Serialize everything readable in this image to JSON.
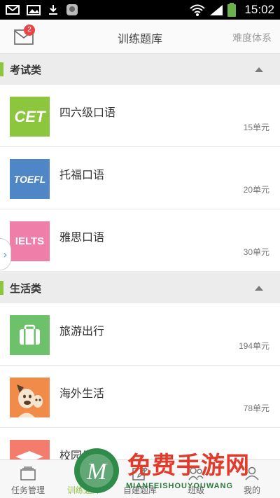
{
  "status_bar": {
    "time": "15:02"
  },
  "header": {
    "title": "训练题库",
    "right_label": "难度体系",
    "mail_badge": "2"
  },
  "sections": [
    {
      "title": "考试类",
      "items": [
        {
          "name": "四六级口语",
          "units": "15单元",
          "thumb_text": "CET",
          "thumb_color": "#8cc63e"
        },
        {
          "name": "托福口语",
          "units": "20单元",
          "thumb_text": "TOEFL",
          "thumb_color": "#4f86c6"
        },
        {
          "name": "雅思口语",
          "units": "30单元",
          "thumb_text": "IELTS",
          "thumb_color": "#ef7ea8"
        }
      ]
    },
    {
      "title": "生活类",
      "items": [
        {
          "name": "旅游出行",
          "units": "194单元",
          "thumb_text": "",
          "thumb_color": "#6cc16a",
          "icon": "suitcase-icon"
        },
        {
          "name": "海外生活",
          "units": "78单元",
          "thumb_text": "",
          "thumb_color": "#f08b4a",
          "icon": "dog-icon"
        },
        {
          "name": "校园生活",
          "units": "",
          "thumb_text": "",
          "thumb_color": "#f47c6c",
          "icon": "graduation-cap-icon"
        }
      ]
    }
  ],
  "bottom_nav": [
    {
      "label": "任务管理",
      "icon": "task-icon",
      "active": false
    },
    {
      "label": "训练题库",
      "icon": "book-icon",
      "active": true
    },
    {
      "label": "自建题库",
      "icon": "edit-icon",
      "active": false
    },
    {
      "label": "班级",
      "icon": "class-icon",
      "active": false
    },
    {
      "label": "我的",
      "icon": "user-icon",
      "active": false
    }
  ],
  "watermark": {
    "main": "免费手游网",
    "sub": "MIANFEISHOUYOUWANG"
  },
  "colors": {
    "accent": "#8cc63e",
    "badge": "#e84646",
    "watermark_red": "#e23b2c"
  }
}
